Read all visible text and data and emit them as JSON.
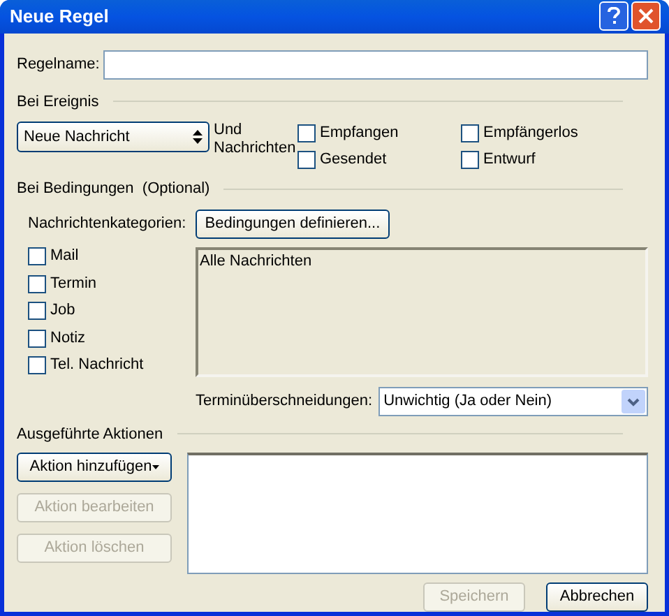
{
  "window": {
    "title": "Neue Regel"
  },
  "rule_name": {
    "label": "Regelname:"
  },
  "event": {
    "heading": "Bei Ereignis",
    "dropdown": "Neue Nachricht",
    "and_label": "Und Nachrichten",
    "options": [
      {
        "label": "Empfangen",
        "checked": false
      },
      {
        "label": "Empfängerlos",
        "checked": false
      },
      {
        "label": "Gesendet",
        "checked": false
      },
      {
        "label": "Entwurf",
        "checked": false
      }
    ]
  },
  "conditions": {
    "heading": "Bei Bedingungen  (Optional)",
    "categories_label": "Nachrichtenkategorien:",
    "define_button": "Bedingungen definieren...",
    "categories": [
      {
        "label": "Mail",
        "checked": false
      },
      {
        "label": "Termin",
        "checked": false
      },
      {
        "label": "Job",
        "checked": false
      },
      {
        "label": "Notiz",
        "checked": false
      },
      {
        "label": "Tel. Nachricht",
        "checked": false
      }
    ],
    "summary_items": [
      "Alle Nachrichten"
    ],
    "overlap": {
      "label": "Terminüberschneidungen:",
      "value": "Unwichtig (Ja oder Nein)"
    }
  },
  "actions": {
    "heading": "Ausgeführte Aktionen",
    "buttons": [
      {
        "label": "Aktion hinzufügen",
        "kind": "menu",
        "disabled": false
      },
      {
        "label": "Aktion bearbeiten",
        "kind": "plain",
        "disabled": true
      },
      {
        "label": "Aktion löschen",
        "kind": "plain",
        "disabled": true
      }
    ]
  },
  "footer_buttons": [
    {
      "label": "Speichern",
      "disabled": true
    },
    {
      "label": "Abbrechen",
      "disabled": false
    }
  ]
}
